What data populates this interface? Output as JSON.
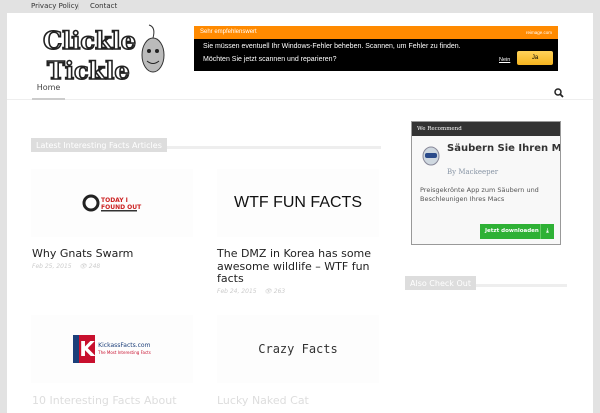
{
  "topbar": {
    "links": [
      "Privacy Policy",
      "Contact"
    ]
  },
  "logo": {
    "text": "Clickle Tickle"
  },
  "ad": {
    "header": "Sehr empfehlenswert",
    "source": "reimage.com",
    "line1": "Sie müssen eventuell Ihr Windows-Fehler beheben. Scannen, um Fehler zu finden.",
    "line2": "Möchten Sie jetzt scannen und reparieren?",
    "no": "Nein",
    "yes": "Ja"
  },
  "nav": {
    "home": "Home"
  },
  "main": {
    "section_title": "Latest Interesting Facts Articles",
    "articles": [
      {
        "thumb": "TODAY I FOUND OUT",
        "title": "Why Gnats Swarm",
        "date": "Feb 25, 2015",
        "views": "248"
      },
      {
        "thumb": "WTF FUN FACTS",
        "title": "The DMZ in Korea has some awesome wildlife –  WTF fun facts",
        "date": "Feb 24, 2015",
        "views": "263"
      },
      {
        "thumb": "KickassFacts.com",
        "thumb_sub": "The Most Interesting Facts",
        "title": "10 Interesting Facts About",
        "date": "",
        "views": ""
      },
      {
        "thumb": "Crazy Facts",
        "title": "Lucky Naked Cat",
        "date": "",
        "views": ""
      }
    ]
  },
  "sidebar": {
    "widget": {
      "header": "We Recommend",
      "title": "Säubern Sie Ihren Mac",
      "by": "By Mackeeper",
      "desc": "Preisgekrönte App zum Säubern und Beschleunigen Ihres Macs",
      "button": "Jetzt downloaden"
    },
    "section_title": "Also Check Out"
  }
}
